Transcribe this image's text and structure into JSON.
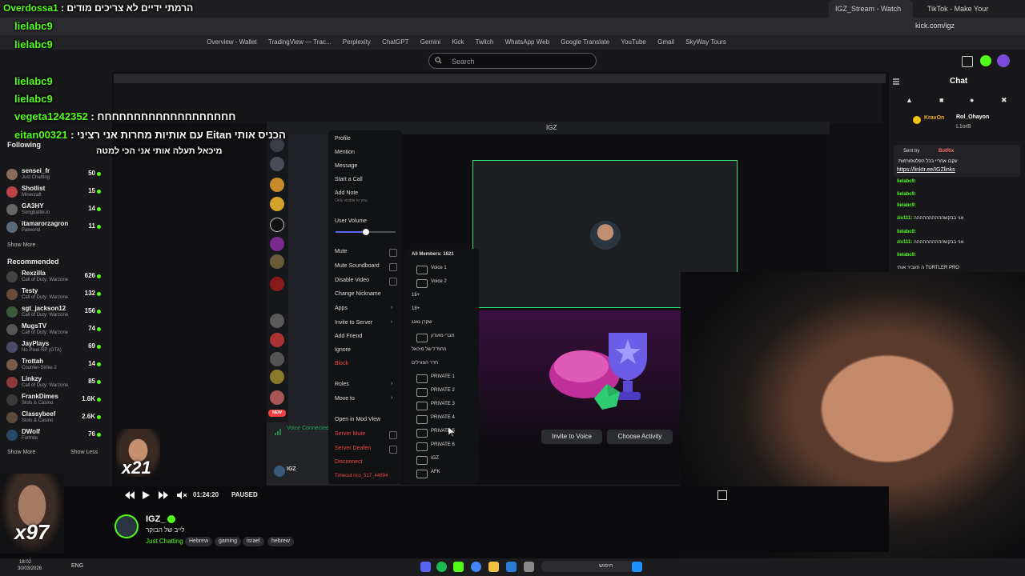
{
  "browser": {
    "tabs": [
      {
        "label": "IGZ_Stream - Watch Live on Ki",
        "active": true
      },
      {
        "label": "TikTok - Make Your Day",
        "active": false
      }
    ],
    "url": "kick.com/igz",
    "bookmarks": [
      "Overview - Wallet",
      "TradingView — Trac...",
      "Perplexity",
      "ChatGPT",
      "Gemini",
      "Kick",
      "Twitch",
      "WhatsApp Web",
      "Google Translate",
      "YouTube",
      "Gmail",
      "SkyWay Tours"
    ]
  },
  "kick": {
    "search_placeholder": "Search"
  },
  "overlay_chat": [
    {
      "user": "Overdossa1",
      "text": "הרמתי ידיים לא צריכים מודים"
    },
    {
      "user": "lielabc9",
      "text": ""
    },
    {
      "user": "lielabc9",
      "text": ""
    },
    {
      "user": "lielabc9",
      "text": ""
    },
    {
      "user": "lielabc9",
      "text": ""
    },
    {
      "user": "vegeta1242352",
      "text": "חחחחחחחחחחחחחחחחחחח"
    },
    {
      "user": "eitan00321",
      "text": "עם אותיות מחרות אני רציני Eitan הכניס אותי"
    },
    {
      "user": "",
      "text": "מיכאל תעלה אותי אני הכי למטה"
    }
  ],
  "sidebar": {
    "following_label": "Following",
    "following": [
      {
        "name": "sensei_fr",
        "game": "Just Chatting",
        "viewers": "50"
      },
      {
        "name": "Shotlist",
        "game": "Minecraft",
        "viewers": "15"
      },
      {
        "name": "GA3HY",
        "game": "Songbattle.io",
        "viewers": "14"
      },
      {
        "name": "itamarorzagron",
        "game": "Palworld",
        "viewers": "11"
      }
    ],
    "show_more": "Show More",
    "recommended_label": "Recommended",
    "recommended": [
      {
        "name": "Rexzilla",
        "game": "Call of Duty: Warzone",
        "viewers": "626"
      },
      {
        "name": "Testy",
        "game": "Call of Duty: Warzone",
        "viewers": "132"
      },
      {
        "name": "sgt_jackson12",
        "game": "Call of Duty: Warzone",
        "viewers": "156"
      },
      {
        "name": "MugsTV",
        "game": "Call of Duty: Warzone",
        "viewers": "74"
      },
      {
        "name": "JayPlays",
        "game": "No Pixel RP (GTA)",
        "viewers": "69"
      },
      {
        "name": "Trottah",
        "game": "Counter-Strike 2",
        "viewers": "14"
      },
      {
        "name": "Linkzy",
        "game": "Call of Duty: Warzone",
        "viewers": "85"
      },
      {
        "name": "FrankDimes",
        "game": "Slots & Casino",
        "viewers": "1.6K"
      },
      {
        "name": "Classybeef",
        "game": "Slots & Casino",
        "viewers": "2.6K"
      },
      {
        "name": "DWolf",
        "game": "Fortnite",
        "viewers": "76"
      }
    ],
    "show_less": "Show Less"
  },
  "discord": {
    "window_title": "IGZ",
    "context_menu": {
      "items": [
        "Profile",
        "Mention",
        "Message",
        "Start a Call",
        "Add Note"
      ],
      "note_hint": "Only visible to you",
      "user_volume": "User Volume",
      "volume_fraction": 0.5,
      "toggles": [
        "Mute",
        "Mute Soundboard",
        "Disable Video"
      ],
      "items2": [
        "Change Nickname",
        "Apps",
        "Invite to Server",
        "Add Friend",
        "Ignore"
      ],
      "block": "Block",
      "roles": "Roles",
      "move_to": "Move to",
      "mod_view": "Open in Mod View",
      "server_mute": "Server Mute",
      "server_deafen": "Server Deafen",
      "disconnect": "Disconnect",
      "timeout": "Timeout rico_517_44694"
    },
    "move_to_menu": {
      "header": "All Members: 1621",
      "channels": [
        "Voice 1",
        "Voice 2",
        "16+",
        "18+",
        "שקרן גאנג",
        "חברי מועדון",
        "החמ\"ל של מיכאל",
        "חדר הפורלים",
        "PRIVATE 1",
        "PRIVATE 2",
        "PRIVATE 3",
        "PRIVATE 4",
        "PRIVATE 5",
        "PRIVATE 6",
        "IGZ",
        "AFK"
      ]
    },
    "invite_voice": "Invite to Voice",
    "choose_activity": "Choose Activity",
    "voice_connected": "Voice Connected",
    "user_badge": "NEW",
    "username": "IGZ"
  },
  "player": {
    "time": "01:24:20",
    "status": "PAUSED"
  },
  "chat": {
    "title": "Chat",
    "pinned_user": "Rol_Ohayon",
    "pinned_user2": "KravOn",
    "pinned_user3": "L1orB",
    "sent_by": "Sent by",
    "bot_name": "BotRix",
    "bot_msg": "עקבו אחריי בכל הפלטפורמות",
    "bot_link": "https://linktr.ee/IGZlinks",
    "lines": [
      {
        "user": "lielabc9:",
        "text": ""
      },
      {
        "user": "lielabc9:",
        "text": ""
      },
      {
        "user": "lielabc9:",
        "text": ""
      },
      {
        "user": "ziv111:",
        "text": "אני בבקשהההההההההה"
      },
      {
        "user": "lielabc9:",
        "text": ""
      },
      {
        "user": "ziv111:",
        "text": "אני בבקשהההההההההה"
      },
      {
        "user": "lielabc9:",
        "text": ""
      },
      {
        "user": "",
        "text": "ה תעביר אותי TURTLER PRO"
      }
    ]
  },
  "channel": {
    "name": "IGZ_",
    "title": "לייב של הבוקר",
    "category": "Just Chatting",
    "tags": [
      "Hebrew",
      "gaming",
      "israel",
      "hebrew"
    ]
  },
  "taskbar": {
    "time": "18:02",
    "date": "30/03/2026",
    "lang": "ENG",
    "search": "חיפוש"
  },
  "cam_labels": {
    "left_cam": "x97",
    "inner_cam": "x21"
  },
  "colors": {
    "kick_green": "#53fc18",
    "discord_blurple": "#5865f2",
    "danger": "#f04747",
    "voice_green": "#23a55a"
  }
}
